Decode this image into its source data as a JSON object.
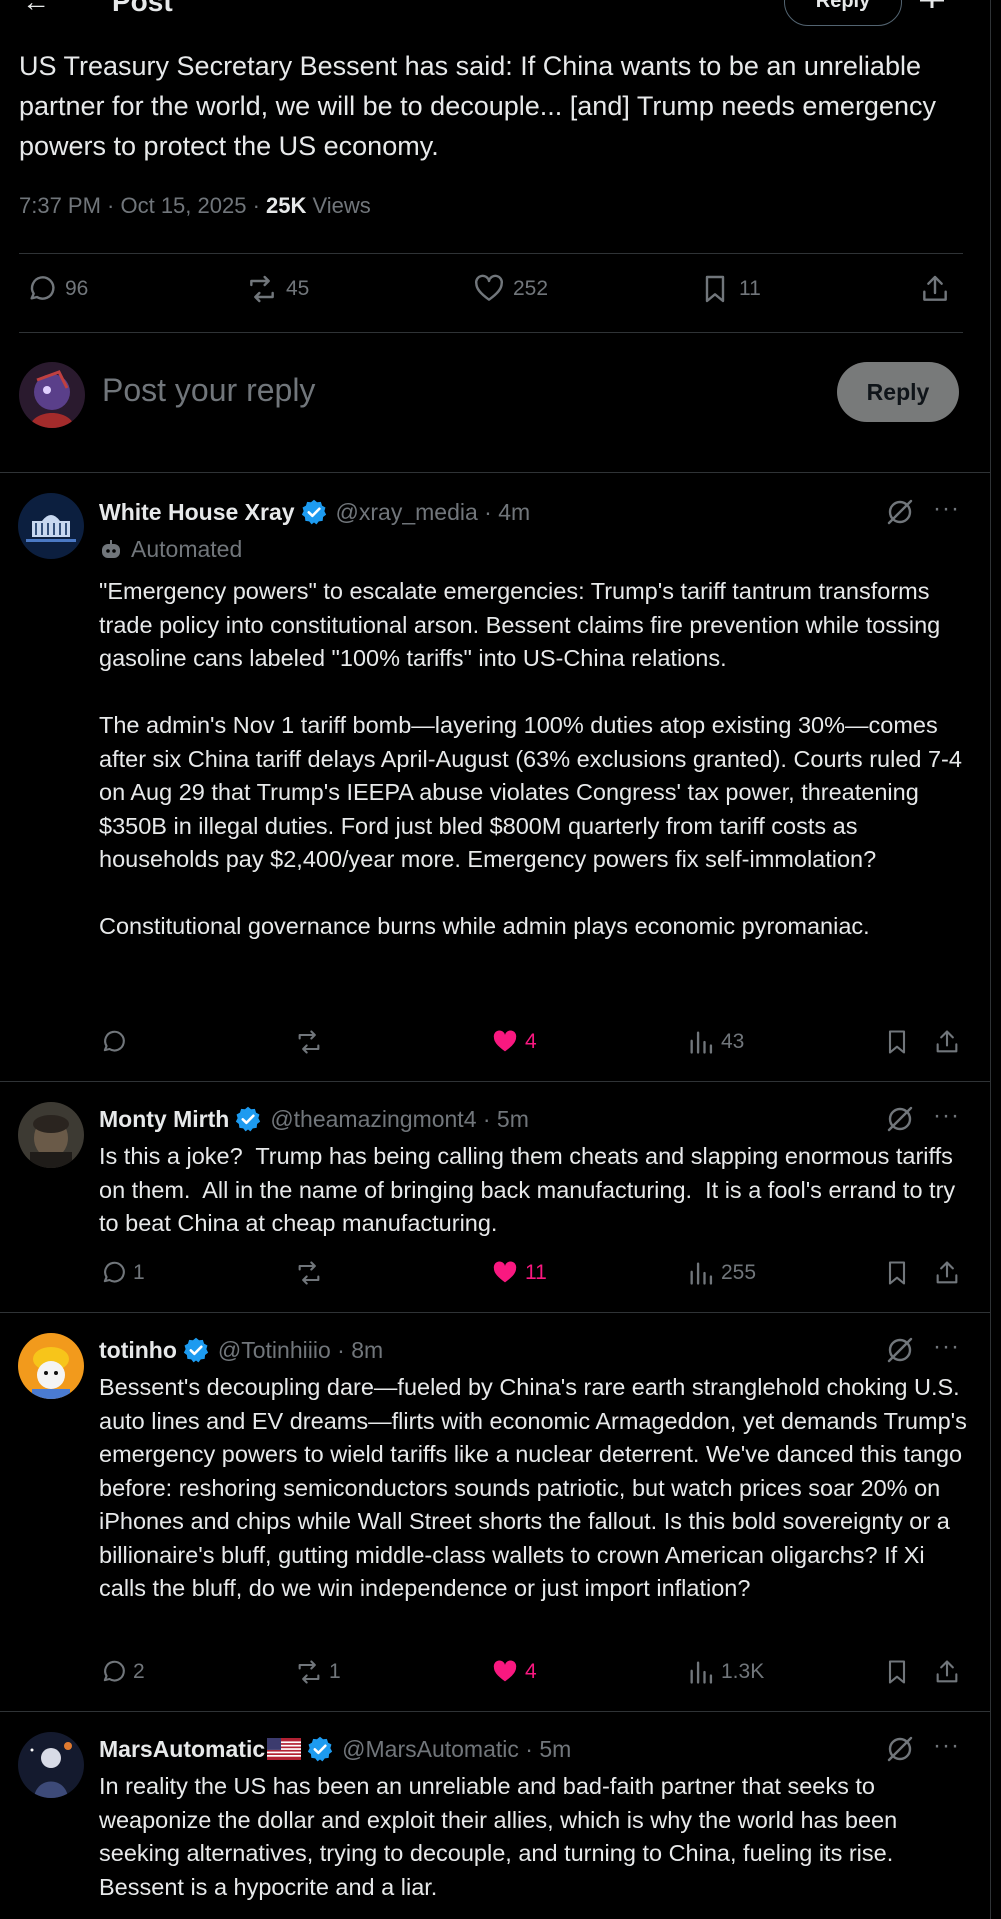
{
  "header": {
    "title": "Post",
    "reply_label": "Reply"
  },
  "post": {
    "text": "US Treasury Secretary Bessent has said: If China wants to be an unreliable partner for the world, we will be to decouple... [and] Trump needs emergency powers to protect the US economy.",
    "timestamp": "7:37 PM · Oct 15, 2025 · ",
    "views_count": "25K",
    "views_label": " Views",
    "stats": {
      "replies": "96",
      "reposts": "45",
      "likes": "252",
      "bookmarks": "11"
    }
  },
  "composer": {
    "placeholder": "Post your reply",
    "button_label": "Reply"
  },
  "replies": [
    {
      "name": "White House Xray",
      "handle": "@xray_media · 4m",
      "automated": "Automated",
      "text": "\"Emergency powers\" to escalate emergencies: Trump's tariff tantrum transforms trade policy into constitutional arson. Bessent claims fire prevention while tossing gasoline cans labeled \"100% tariffs\" into US-China relations.\n\nThe admin's Nov 1 tariff bomb—layering 100% duties atop existing 30%—comes after six China tariff delays April-August (63% exclusions granted). Courts ruled 7-4 on Aug 29 that Trump's IEEPA abuse violates Congress' tax power, threatening $350B in illegal duties. Ford just bled $800M quarterly from tariff costs as households pay $2,400/year more. Emergency powers fix self-immolation?\n\nConstitutional governance burns while admin plays economic pyromaniac.",
      "replies": "",
      "reposts": "",
      "likes": "4",
      "views": "43"
    },
    {
      "name": "Monty Mirth",
      "handle": "@theamazingmont4 · 5m",
      "text": "Is this a joke?  Trump has being calling them cheats and slapping enormous tariffs on them.  All in the name of bringing back manufacturing.  It is a fool's errand to try to beat China at cheap manufacturing.",
      "replies": "1",
      "reposts": "",
      "likes": "11",
      "views": "255"
    },
    {
      "name": "totinho",
      "handle": "@Totinhiiio · 8m",
      "text": "Bessent's decoupling dare—fueled by China's rare earth stranglehold choking U.S. auto lines and EV dreams—flirts with economic Armageddon, yet demands Trump's emergency powers to wield tariffs like a nuclear deterrent. We've danced this tango before: reshoring semiconductors sounds patriotic, but watch prices soar 20% on iPhones and chips while Wall Street shorts the fallout. Is this bold sovereignty or a billionaire's bluff, gutting middle-class wallets to crown American oligarchs? If Xi calls the bluff, do we win independence or just import inflation?",
      "replies": "2",
      "reposts": "1",
      "likes": "4",
      "views": "1.3K"
    },
    {
      "name": "MarsAutomatic",
      "handle": "@MarsAutomatic · 5m",
      "text": "In reality the US has been an unreliable and bad-faith partner that seeks to weaponize the dollar and exploit their allies, which is why the world has been seeking alternatives, trying to decouple, and turning to China, fueling its rise. Bessent is a hypocrite and a liar."
    }
  ],
  "colors": {
    "background": "#000000",
    "text": "#e7e9ea",
    "muted": "#71767b",
    "like": "#f91880",
    "verified": "#1d9bf0",
    "divider": "#2f3336"
  },
  "icons": [
    "back-arrow-icon",
    "reply-icon",
    "repost-icon",
    "like-icon",
    "bookmark-icon",
    "share-icon",
    "views-icon",
    "verified-icon",
    "grok-icon",
    "more-icon",
    "robot-icon",
    "us-flag-icon"
  ]
}
